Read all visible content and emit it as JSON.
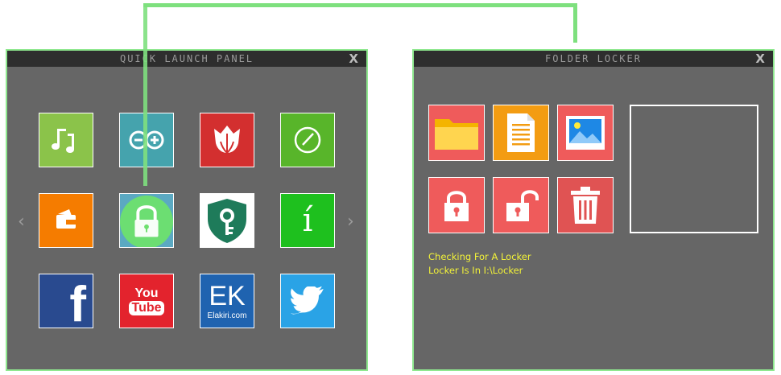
{
  "quick_launch": {
    "title": "QUICK LAUNCH PANEL",
    "close": "X",
    "prev_arrow": "‹",
    "next_arrow": "›",
    "tiles": [
      {
        "name": "music-app-tile",
        "icon": "music-note-icon",
        "color": "#8bc34a"
      },
      {
        "name": "arduino-app-tile",
        "icon": "arduino-icon",
        "color": "#45a3ad"
      },
      {
        "name": "photo-tulip-app-tile",
        "icon": "tulip-icon",
        "color": "#d32f2f"
      },
      {
        "name": "clock-app-tile",
        "icon": "clock-icon",
        "color": "#58b52a"
      },
      {
        "name": "wallet-app-tile",
        "icon": "wallet-icon",
        "color": "#f57c00"
      },
      {
        "name": "folder-locker-app-tile",
        "icon": "padlock-icon",
        "color": "#5ba9c2"
      },
      {
        "name": "key-shield-app-tile",
        "icon": "shield-key-icon",
        "color": "#ffffff"
      },
      {
        "name": "ime-app-tile",
        "icon": "i-accent-icon",
        "color": "#1ec01e",
        "glyph": "í"
      },
      {
        "name": "facebook-app-tile",
        "icon": "facebook-icon",
        "color": "#294a8f",
        "glyph": "f"
      },
      {
        "name": "youtube-app-tile",
        "icon": "youtube-icon",
        "color": "#e3232d",
        "glyph_top": "You",
        "glyph_bottom": "Tube"
      },
      {
        "name": "elakiri-app-tile",
        "icon": "elakiri-logo-icon",
        "color": "#1f63b0",
        "glyph_top": "EK",
        "glyph_bottom": "Elakiri.com"
      },
      {
        "name": "twitter-app-tile",
        "icon": "twitter-bird-icon",
        "color": "#2aa3e6"
      }
    ]
  },
  "folder_locker": {
    "title": "FOLDER LOCKER",
    "close": "X",
    "buttons": [
      {
        "name": "open-folder-button",
        "icon": "folder-icon",
        "color": "#ef5b5b"
      },
      {
        "name": "open-document-button",
        "icon": "document-icon",
        "color": "#ef5b5b"
      },
      {
        "name": "open-image-button",
        "icon": "image-icon",
        "color": "#ef5b5b"
      },
      {
        "name": "lock-button",
        "icon": "lock-closed-icon",
        "color": "#ef5b5b"
      },
      {
        "name": "unlock-button",
        "icon": "lock-open-icon",
        "color": "#ef5b5b"
      },
      {
        "name": "delete-button",
        "icon": "trash-icon",
        "color": "#e05353"
      }
    ],
    "status": [
      "Checking For A Locker",
      "Locker Is In I:\\Locker"
    ]
  },
  "colors": {
    "accent": "#7ee07e",
    "window_bg": "#666666",
    "titlebar_bg": "#2e2e2e",
    "status_text": "#f2f238"
  }
}
